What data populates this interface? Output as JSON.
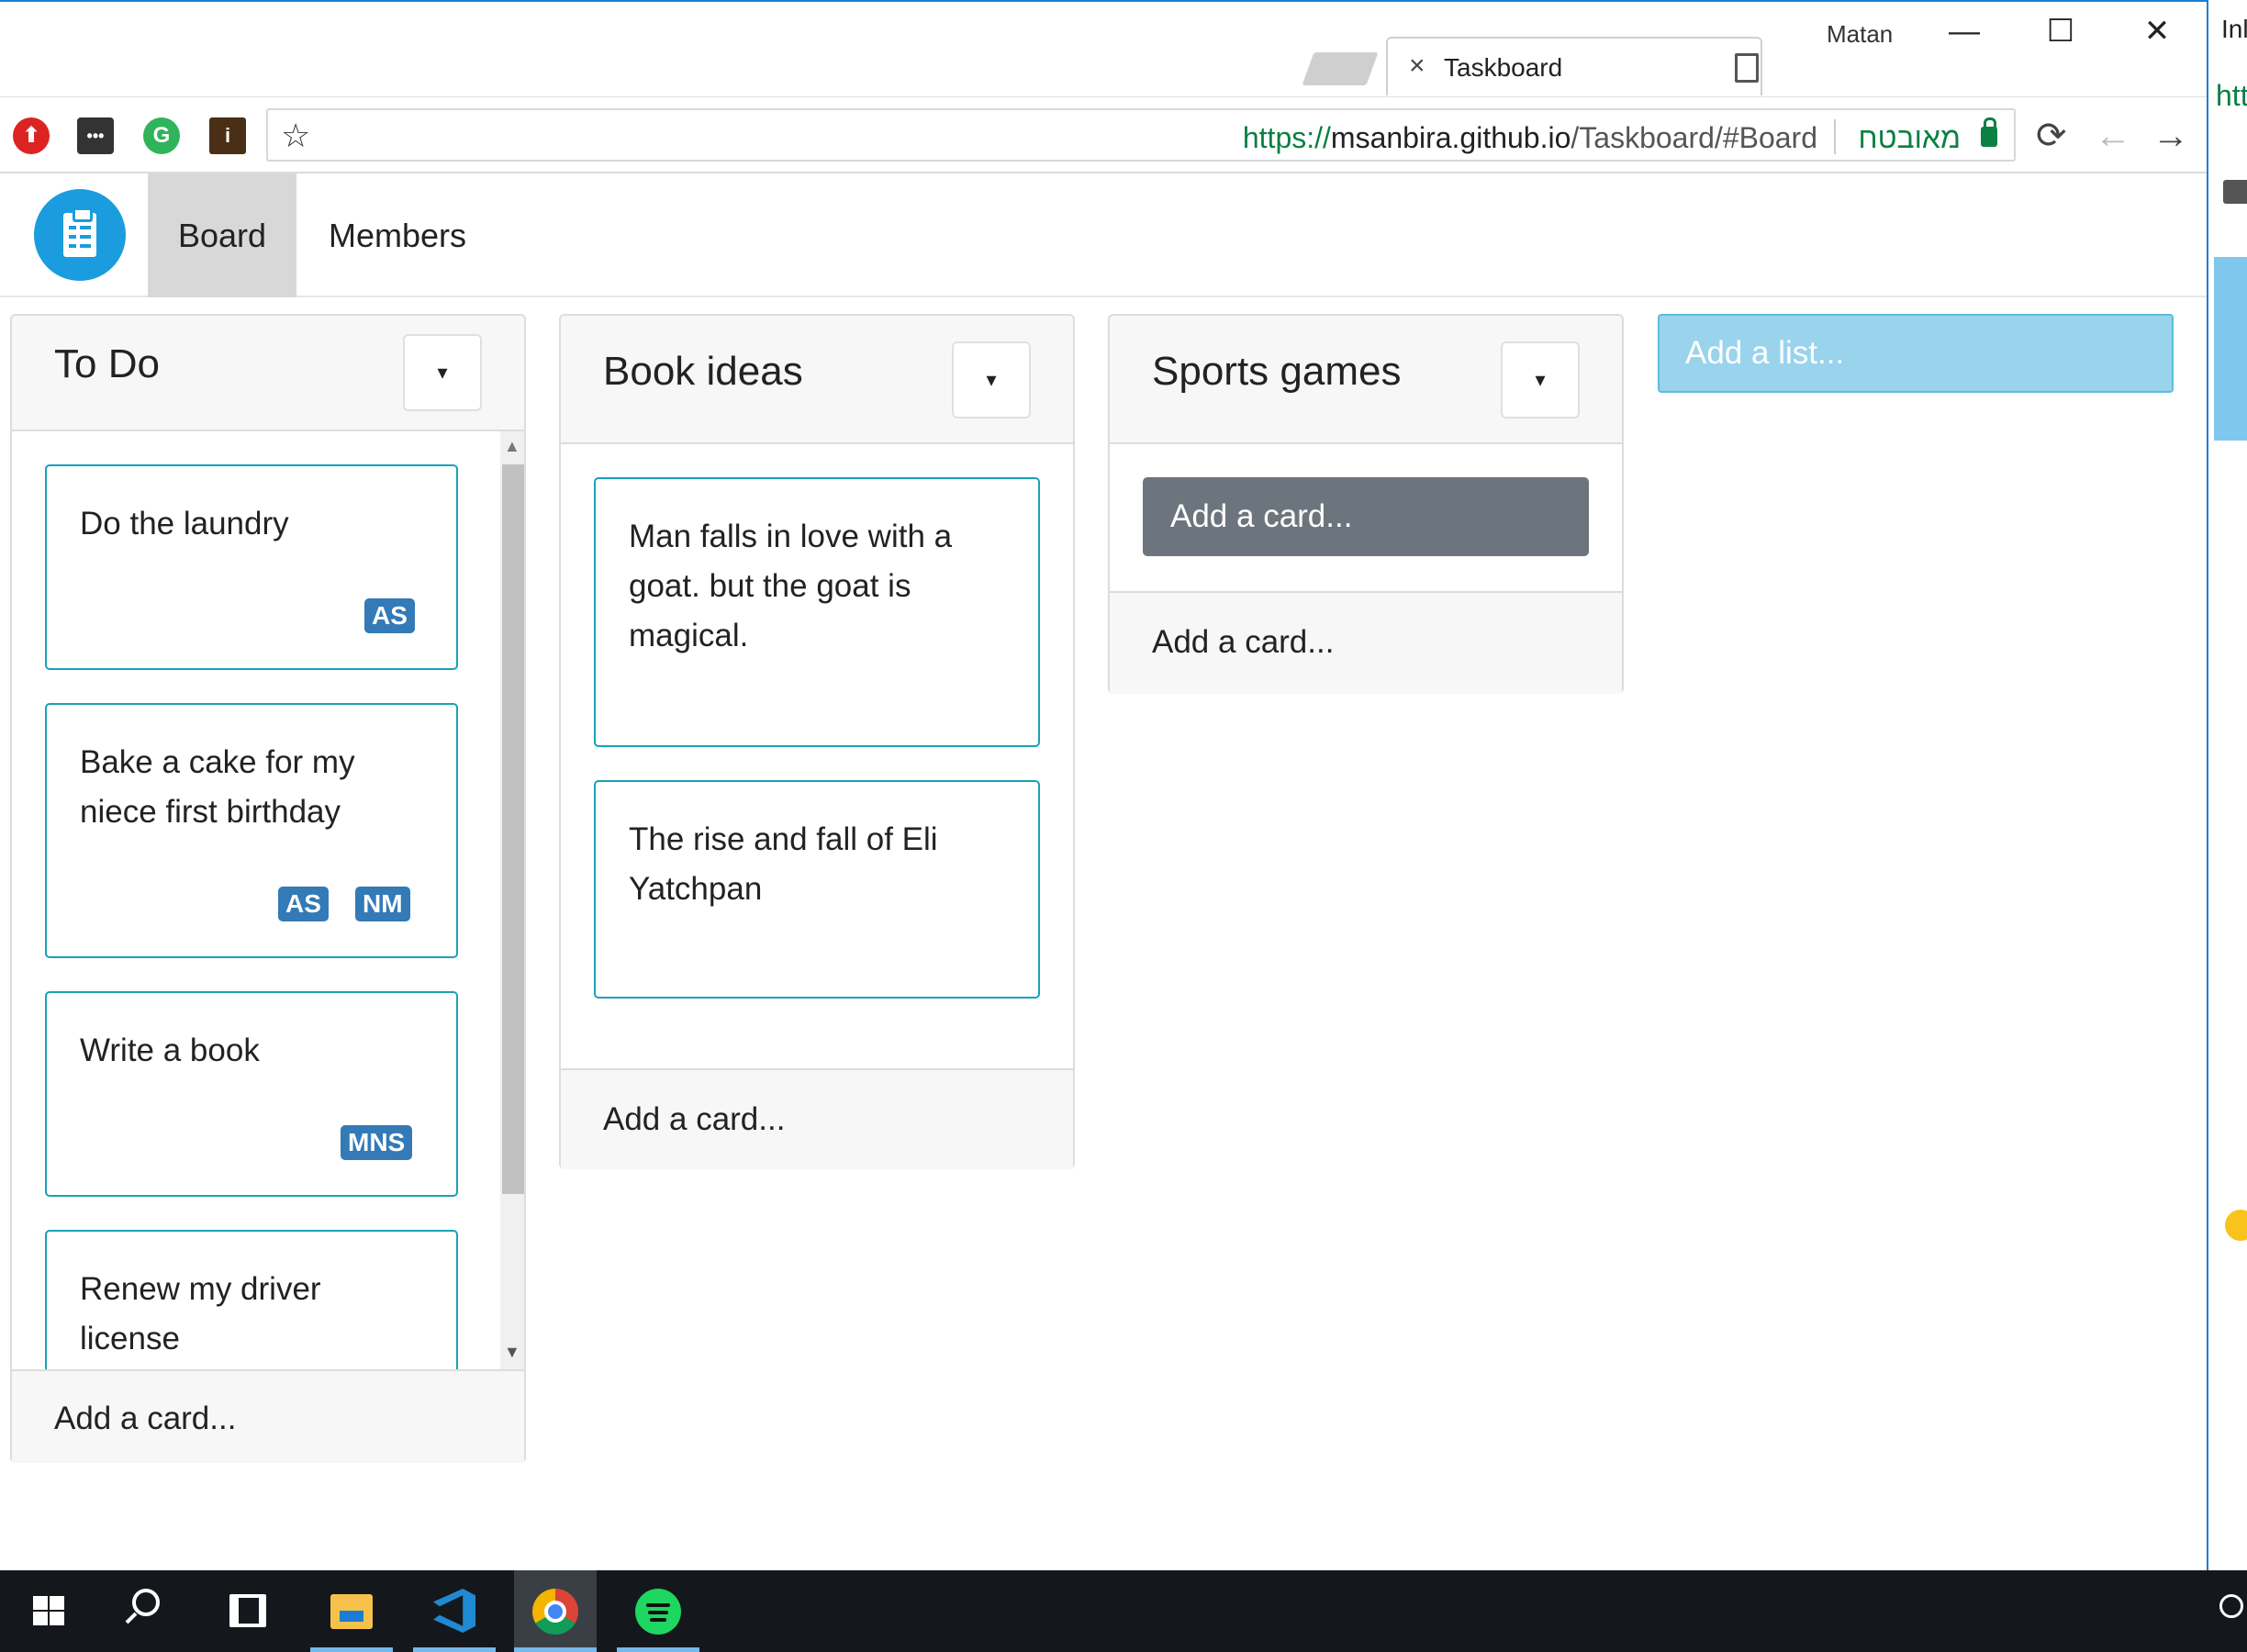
{
  "browser": {
    "user_name": "Matan",
    "tab_title": "Taskboard",
    "tab_close": "×",
    "win_minimize": "—",
    "win_maximize": "☐",
    "win_close": "✕",
    "url_scheme": "https://",
    "url_host": "msanbira.github.io",
    "url_path": "/Taskboard/#Board",
    "secure_label": "מאובטח",
    "bookmark_icon": "☆",
    "reload_icon": "⟳",
    "back_icon": "←",
    "forward_icon": "→",
    "extensions": [
      "⬆",
      "•••",
      "G",
      "i"
    ]
  },
  "navbar": {
    "tabs": [
      {
        "label": "Board",
        "active": true
      },
      {
        "label": "Members",
        "active": false
      }
    ]
  },
  "lists": [
    {
      "title": "To Do",
      "toggle": "▾",
      "cards": [
        {
          "text": "Do the laundry",
          "badges": [
            "AS"
          ]
        },
        {
          "text": "Bake a cake for my niece first birthday",
          "badges": [
            "AS",
            "NM"
          ]
        },
        {
          "text": "Write a book",
          "badges": [
            "MNS"
          ]
        },
        {
          "text": "Renew my driver license",
          "badges": []
        }
      ],
      "footer": "Add a card..."
    },
    {
      "title": "Book ideas",
      "toggle": "▾",
      "cards": [
        {
          "text": "Man falls in love with a goat. but the goat is magical.",
          "badges": []
        },
        {
          "text": "The rise and fall of Eli Yatchpan",
          "badges": []
        }
      ],
      "footer": "Add a card..."
    },
    {
      "title": "Sports games",
      "toggle": "▾",
      "cards": [],
      "add_card_input": "Add a card...",
      "footer": "Add a card..."
    }
  ],
  "add_list": {
    "placeholder": "Add a list..."
  },
  "scrollbar": {
    "up": "▲",
    "down": "▼"
  },
  "sliver": {
    "text1": "Inl",
    "text2": "htt"
  },
  "colors": {
    "card_border": "#17a2b8",
    "badge": "#337ab7",
    "logo": "#1a9cde",
    "add_list": "#9ad3ec",
    "add_card_input": "#6c757d"
  }
}
